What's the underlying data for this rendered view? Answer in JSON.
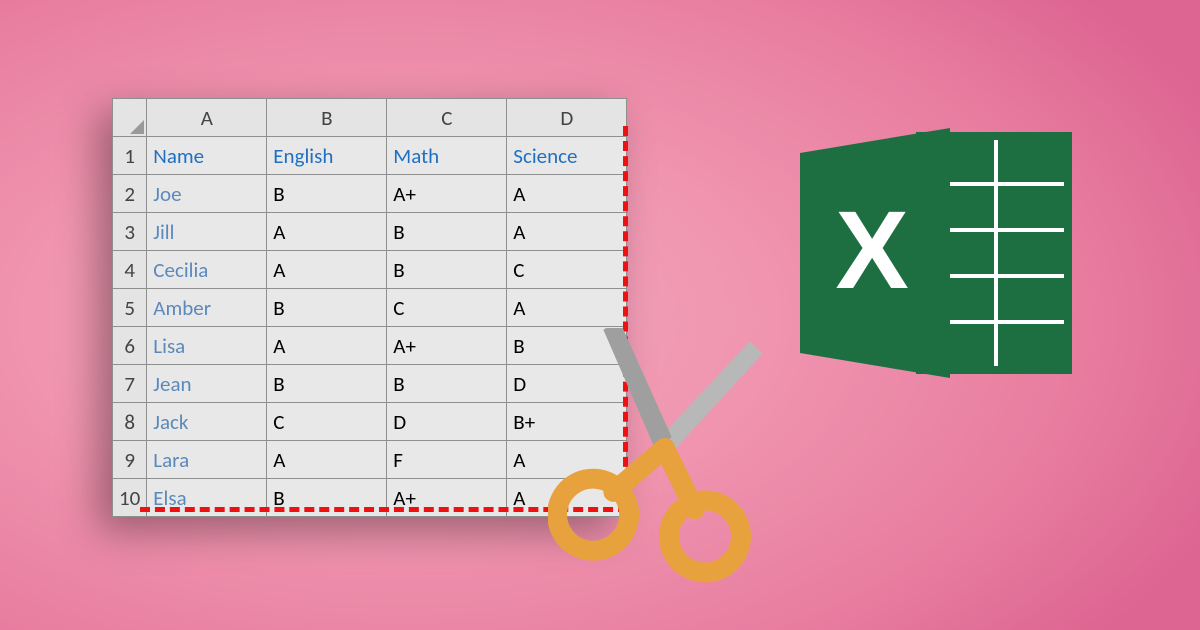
{
  "columns": [
    "A",
    "B",
    "C",
    "D"
  ],
  "header_row": {
    "row_num": "1",
    "cells": [
      "Name",
      "English",
      "Math",
      "Science"
    ]
  },
  "rows": [
    {
      "row_num": "2",
      "cells": [
        "Joe",
        "B",
        "A+",
        "A"
      ]
    },
    {
      "row_num": "3",
      "cells": [
        "Jill",
        "A",
        "B",
        "A"
      ]
    },
    {
      "row_num": "4",
      "cells": [
        "Cecilia",
        "A",
        "B",
        "C"
      ]
    },
    {
      "row_num": "5",
      "cells": [
        "Amber",
        "B",
        "C",
        "A"
      ]
    },
    {
      "row_num": "6",
      "cells": [
        "Lisa",
        "A",
        "A+",
        "B"
      ]
    },
    {
      "row_num": "7",
      "cells": [
        "Jean",
        "B",
        "B",
        "D"
      ]
    },
    {
      "row_num": "8",
      "cells": [
        "Jack",
        "C",
        "D",
        "B+"
      ]
    },
    {
      "row_num": "9",
      "cells": [
        "Lara",
        "A",
        "F",
        "A"
      ]
    },
    {
      "row_num": "10",
      "cells": [
        "Elsa",
        "B",
        "A+",
        "A"
      ]
    }
  ],
  "icons": {
    "excel": "excel-logo",
    "scissors": "scissors-icon"
  },
  "colors": {
    "excel_dark": "#1d6f42",
    "excel_light": "#2a8a54",
    "scissor_handle": "#e8a23d",
    "scissor_blade": "#a9a9a9",
    "dash": "#e11"
  }
}
